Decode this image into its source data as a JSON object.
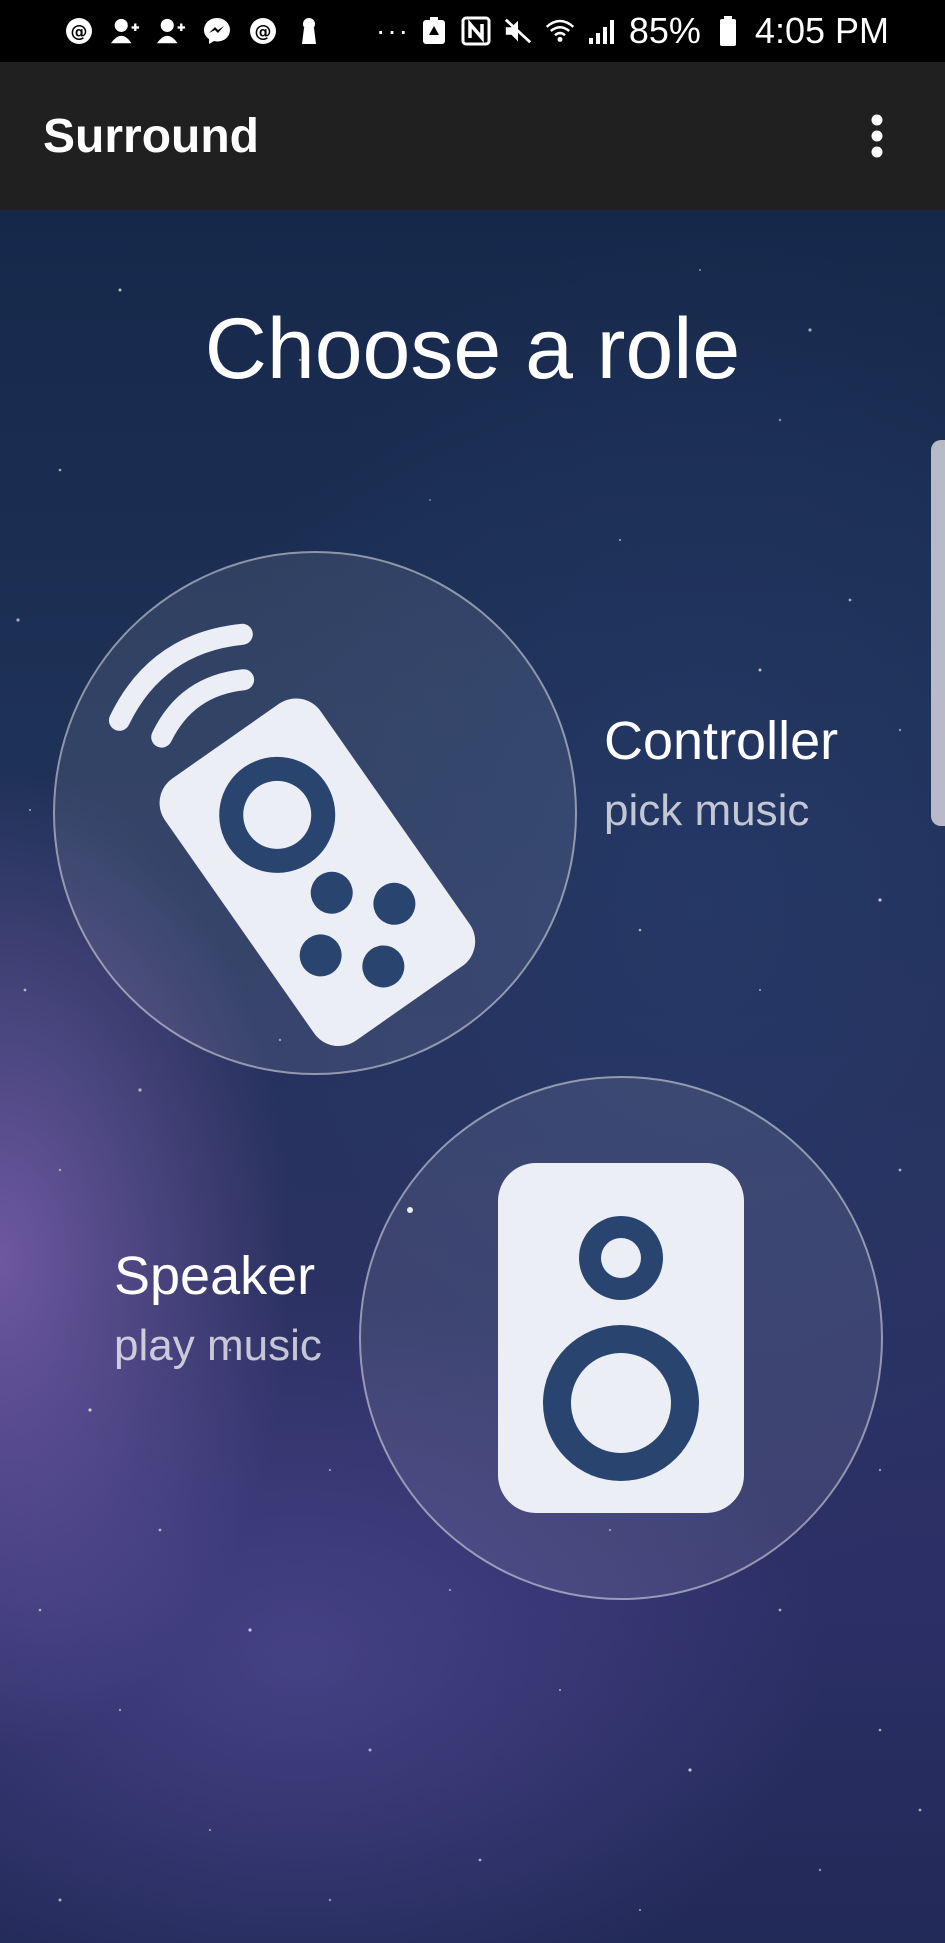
{
  "status_bar": {
    "battery": "85%",
    "time": "4:05 PM",
    "overflow": "···"
  },
  "app_bar": {
    "title": "Surround"
  },
  "main": {
    "heading": "Choose a role",
    "roles": [
      {
        "title": "Controller",
        "subtitle": "pick music",
        "icon": "remote-control-icon"
      },
      {
        "title": "Speaker",
        "subtitle": "play music",
        "icon": "speaker-icon"
      }
    ]
  },
  "colors": {
    "app_bar": "#202020",
    "status_bar": "#000000",
    "icon_fill": "#eceef5",
    "icon_accent": "#2a4470"
  }
}
